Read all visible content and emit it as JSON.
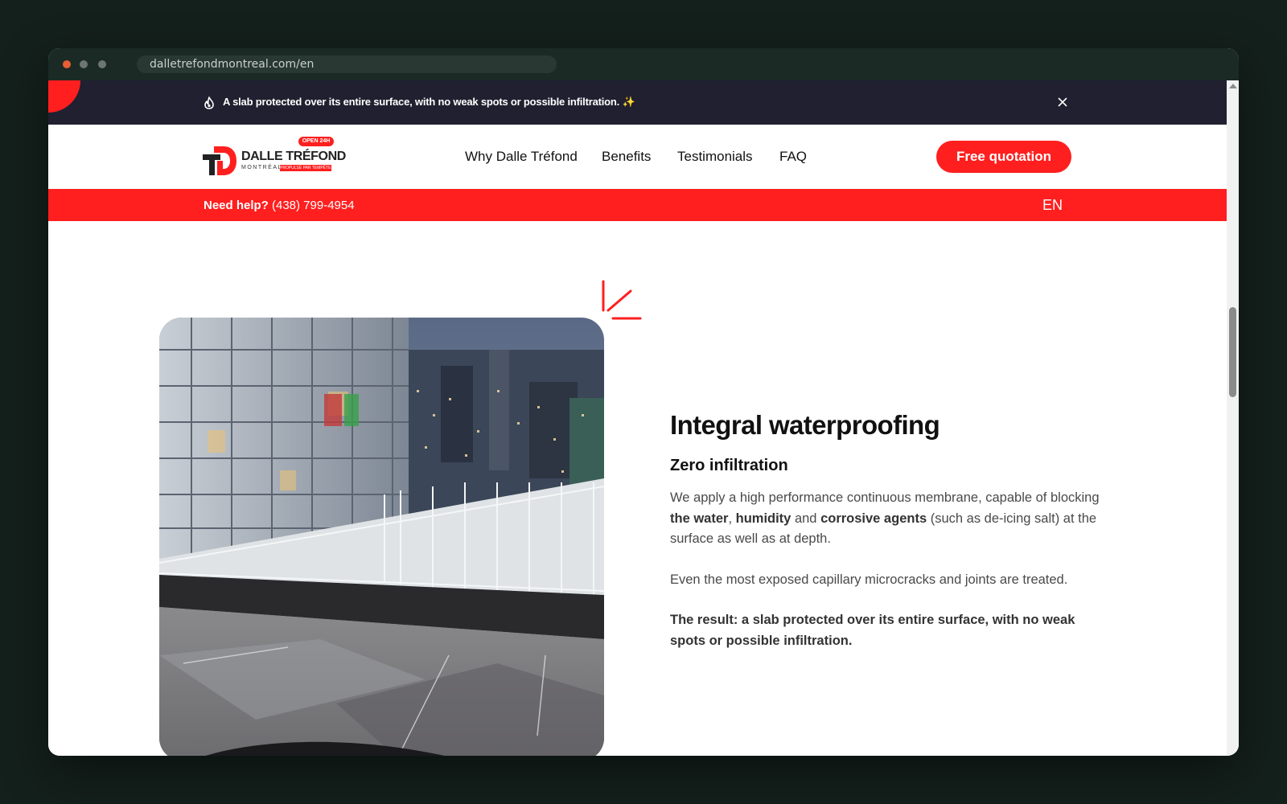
{
  "browser": {
    "url": "dalletrefondmontreal.com/en"
  },
  "announcement": {
    "text": "A slab protected over its entire surface, with no weak spots or possible infiltration. ✨",
    "icon": "fire-icon",
    "close_icon": "close-icon"
  },
  "header": {
    "logo": {
      "badge": "OPEN 24H",
      "name": "DALLE TRÉFOND",
      "city": "MONTRÉAL",
      "tagline": "PROPULSÉ PAR TEMPÊTE LP"
    },
    "nav": [
      "Why Dalle Tréfond",
      "Benefits",
      "Testimonials",
      "FAQ"
    ],
    "cta_label": "Free quotation"
  },
  "helpbar": {
    "need_help": "Need help?",
    "phone": "(438) 799-4954",
    "language": "EN"
  },
  "section": {
    "title": "Integral waterproofing",
    "subtitle": "Zero infiltration",
    "p1": {
      "a": "We apply a high performance continuous membrane, capable of blocking ",
      "b1": "the water",
      "sep1": ", ",
      "b2": "humidity",
      "sep2": " and ",
      "b3": "corrosive agents",
      "c": " (such as de-icing salt) at the surface as well as at depth."
    },
    "p2": "Even the most exposed capillary microcracks and joints are treated.",
    "p3": "The result: a slab protected over its entire surface, with no weak spots or possible infiltration."
  },
  "colors": {
    "brand_red": "#ff1f1f",
    "dark_bar": "#202030",
    "page_bg": "#14201c"
  }
}
